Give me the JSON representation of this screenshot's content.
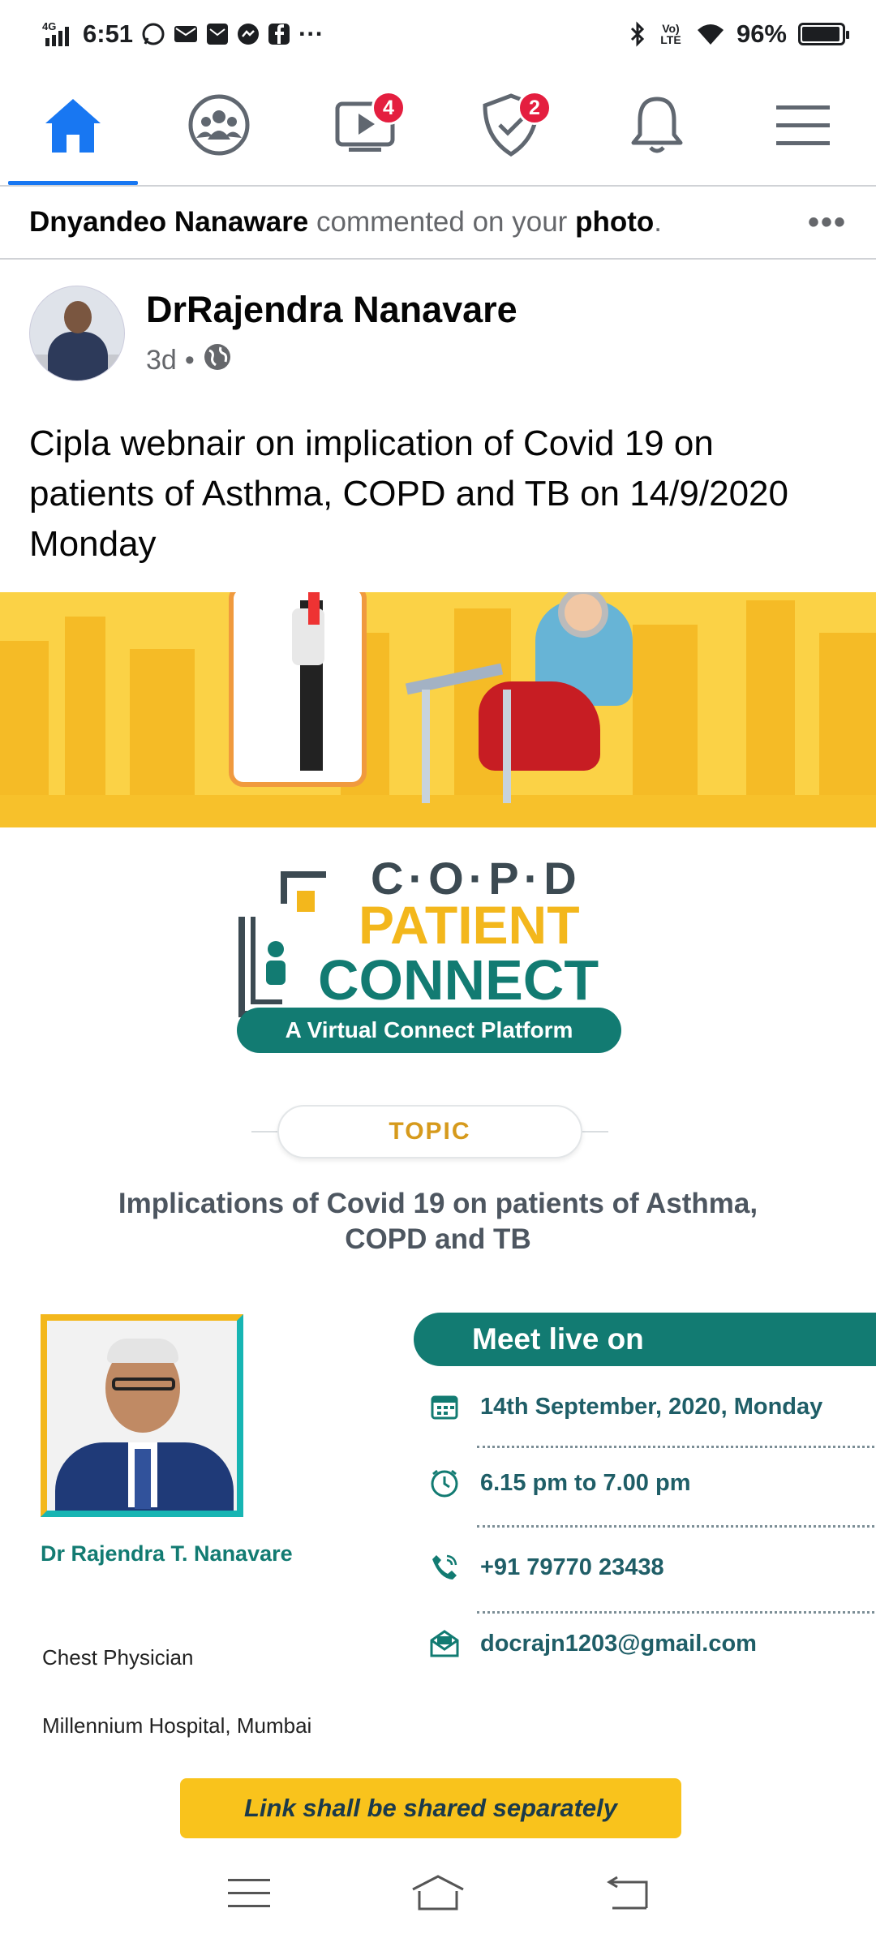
{
  "status_bar": {
    "network": "4G",
    "time": "6:51",
    "overflow": "···",
    "volte": "Vo) LTE",
    "battery": "96%",
    "battery_level": 0.96,
    "icons": [
      "signal-icon",
      "whatsapp-icon",
      "mail-icon",
      "mail-icon",
      "messenger-icon",
      "facebook-icon",
      "bluetooth-icon",
      "wifi-icon",
      "battery-icon"
    ]
  },
  "nav": {
    "tabs": [
      {
        "name": "home",
        "icon": "home-icon",
        "active": true
      },
      {
        "name": "groups",
        "icon": "groups-icon"
      },
      {
        "name": "watch",
        "icon": "watch-icon",
        "badge": "4"
      },
      {
        "name": "pages",
        "icon": "shield-icon",
        "badge": "2"
      },
      {
        "name": "notifications",
        "icon": "bell-icon"
      },
      {
        "name": "menu",
        "icon": "menu-icon"
      }
    ],
    "accent": "#1877f2",
    "badge_color": "#e41e3f"
  },
  "notification": {
    "actor": "Dnyandeo Nanaware",
    "action": " commented on your ",
    "object": "photo",
    "end": ".",
    "more": "•••"
  },
  "post": {
    "author": "DrRajendra Nanavare",
    "time": "3d",
    "separator": "•",
    "privacy_icon": "globe-icon",
    "text": "Cipla webnair on implication of Covid 19 on patients of Asthma, COPD and TB on 14/9/2020 Monday"
  },
  "poster": {
    "logo_letters": "C·O·P·D",
    "logo_patient": "PATIENT",
    "logo_connect": "CONNECT",
    "platform": "A Virtual Connect Platform",
    "topic_label": "TOPIC",
    "topic_text": "Implications of Covid 19 on patients of Asthma, COPD and TB",
    "doctor_name": "Dr Rajendra T. Nanavare",
    "doctor_title": "Chest Physician",
    "doctor_hospital": "Millennium Hospital, Mumbai",
    "meet_header": "Meet live on",
    "date": "14th September, 2020, Monday",
    "time": "6.15 pm to 7.00 pm",
    "phone": "+91 79770 23438",
    "email": "docrajn1203@gmail.com",
    "link_note": "Link shall be shared separately",
    "colors": {
      "teal": "#127b72",
      "yellow": "#f3b71c"
    }
  },
  "system_nav": {
    "buttons": [
      "menu-icon",
      "home-icon",
      "back-icon"
    ]
  }
}
